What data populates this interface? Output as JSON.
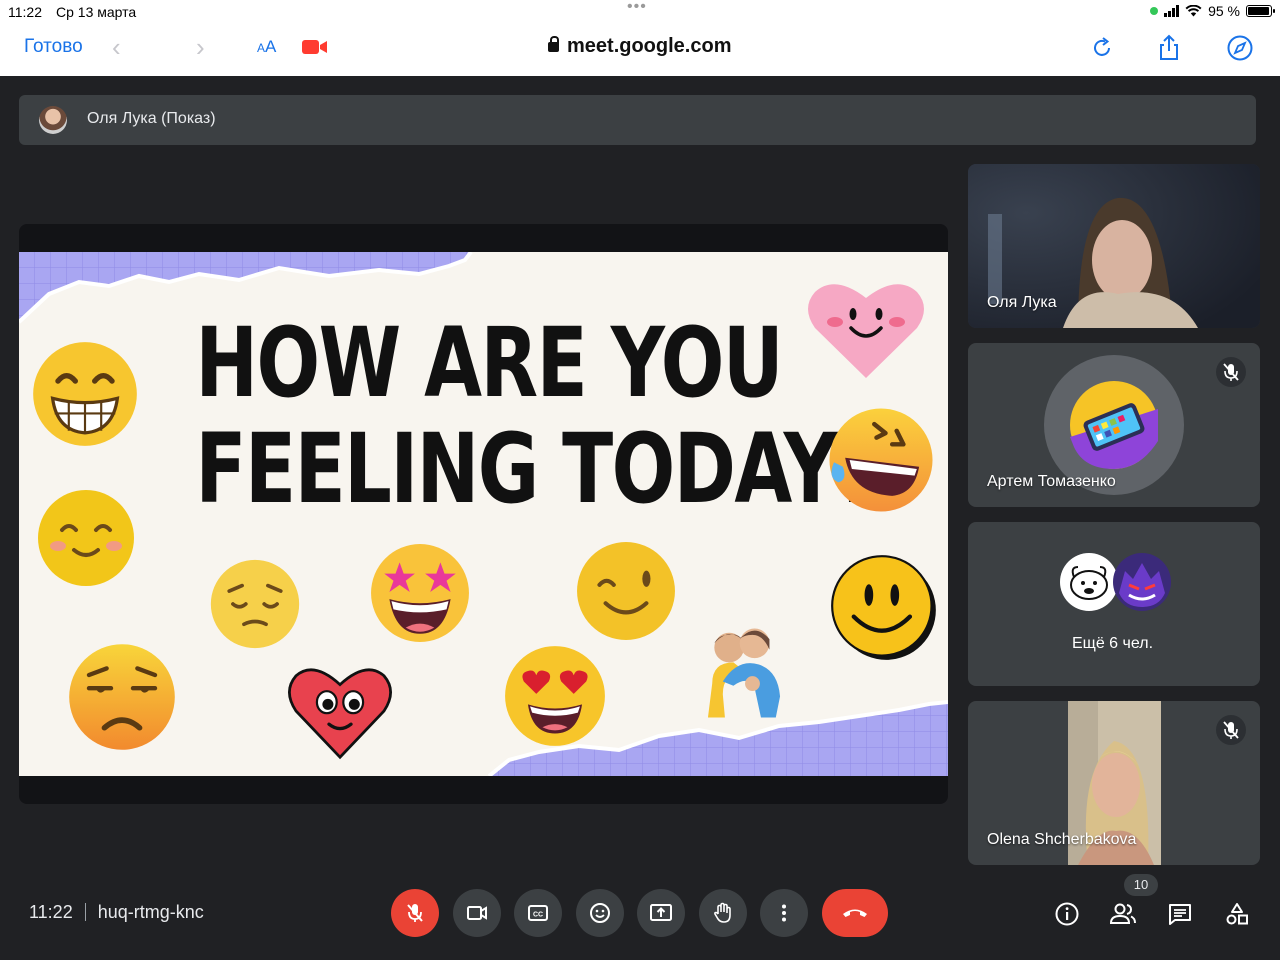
{
  "status_bar": {
    "time": "11:22",
    "date": "Ср 13 марта",
    "battery": "95 %",
    "battery_level": 0.95
  },
  "browser": {
    "done_label": "Готово",
    "text_size_label_small": "A",
    "text_size_label_large": "A",
    "url": "meet.google.com"
  },
  "presentation": {
    "presenter_label": "Оля Лука (Показ)",
    "slide_title_line1": "HOW ARE YOU",
    "slide_title_line2": "FEELING TODAY?"
  },
  "participants": [
    {
      "name": "Оля Лука",
      "muted": false
    },
    {
      "name": "Артем Томазенко",
      "muted": true
    },
    {
      "name": "Ещё 6 чел.",
      "muted": false
    },
    {
      "name": "Olena Shcherbakova",
      "muted": true
    }
  ],
  "meeting": {
    "time": "11:22",
    "code": "huq-rtmg-knc",
    "participant_count": "10"
  },
  "controls": [
    "mic-off",
    "camera",
    "captions",
    "reactions",
    "present",
    "raise-hand",
    "more",
    "leave-call"
  ],
  "colors": {
    "meet_bg": "#202124",
    "tile_bg": "#3c4043",
    "end_red": "#ea4335",
    "ios_blue": "#1a73e8"
  }
}
